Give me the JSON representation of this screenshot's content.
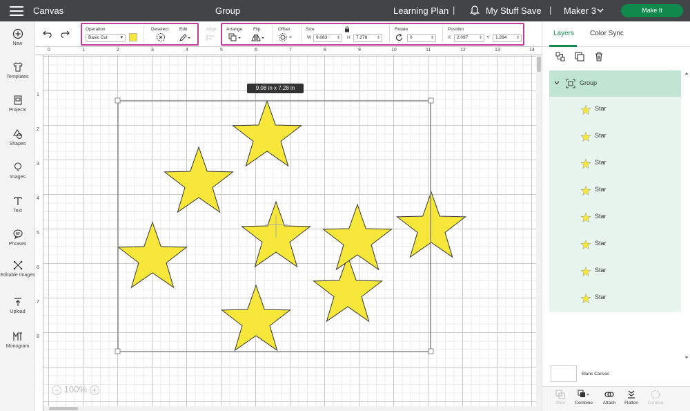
{
  "topbar": {
    "menu_icon": "hamburger-icon",
    "canvas_label": "Canvas",
    "title": "Group",
    "learning_plan": "Learning Plan",
    "sep1": "|",
    "my_stuff": "My Stuff",
    "save": "Save",
    "sep2": "|",
    "machine": "Maker 3",
    "make_it": "Make It",
    "accent": "#0f8a4c"
  },
  "sidebar": {
    "items": [
      {
        "label": "New",
        "icon": "plus-circle-icon"
      },
      {
        "label": "Templates",
        "icon": "shirt-icon"
      },
      {
        "label": "Projects",
        "icon": "projects-icon"
      },
      {
        "label": "Shapes",
        "icon": "shapes-icon"
      },
      {
        "label": "Images",
        "icon": "lightbulb-icon"
      },
      {
        "label": "Text",
        "icon": "text-icon"
      },
      {
        "label": "Phrases",
        "icon": "speech-bubble-icon"
      },
      {
        "label": "Editable Images",
        "icon": "editable-images-icon"
      },
      {
        "label": "Upload",
        "icon": "upload-icon"
      },
      {
        "label": "Monogram",
        "icon": "monogram-icon"
      }
    ]
  },
  "toolbar": {
    "operation_label": "Operation",
    "operation_value": "Basic Cut",
    "swatch_color": "#f7e73a",
    "deselect_label": "Deselect",
    "edit_label": "Edit",
    "align_label": "Align",
    "arrange_label": "Arrange",
    "flip_label": "Flip",
    "offset_label": "Offset",
    "size_label": "Size",
    "w_label": "W",
    "w_value": "9.083",
    "h_label": "H",
    "h_value": "7.278",
    "rotate_label": "Rotate",
    "rotate_value": "0",
    "position_label": "Position",
    "x_label": "X",
    "x_value": "2.097",
    "y_label": "Y",
    "y_value": "1.264",
    "highlight_color": "#c23a97"
  },
  "canvas": {
    "ruler_top": [
      "0",
      "1",
      "2",
      "3",
      "4",
      "5",
      "6",
      "7",
      "8",
      "9",
      "10",
      "11",
      "12",
      "13",
      "14"
    ],
    "ruler_left": [
      "1",
      "2",
      "3",
      "4",
      "5",
      "6",
      "7",
      "8"
    ],
    "dimension_tip": "9.08  in x 7.28  in",
    "zoom_minus": "−",
    "zoom_level": "100%",
    "zoom_plus": "+",
    "star_fill": "#f7e73a"
  },
  "layers_panel": {
    "tab_layers": "Layers",
    "tab_color_sync": "Color Sync",
    "group_label": "Group",
    "items": [
      "Star",
      "Star",
      "Star",
      "Star",
      "Star",
      "Star",
      "Star",
      "Star"
    ],
    "blank_canvas": "Blank Canvas",
    "actions": [
      {
        "label": "Slice",
        "icon": "slice-icon",
        "enabled": false
      },
      {
        "label": "Combine",
        "icon": "combine-icon",
        "enabled": true
      },
      {
        "label": "Attach",
        "icon": "attach-icon",
        "enabled": true
      },
      {
        "label": "Flatten",
        "icon": "flatten-icon",
        "enabled": true
      },
      {
        "label": "Contour",
        "icon": "contour-icon",
        "enabled": false
      }
    ]
  }
}
